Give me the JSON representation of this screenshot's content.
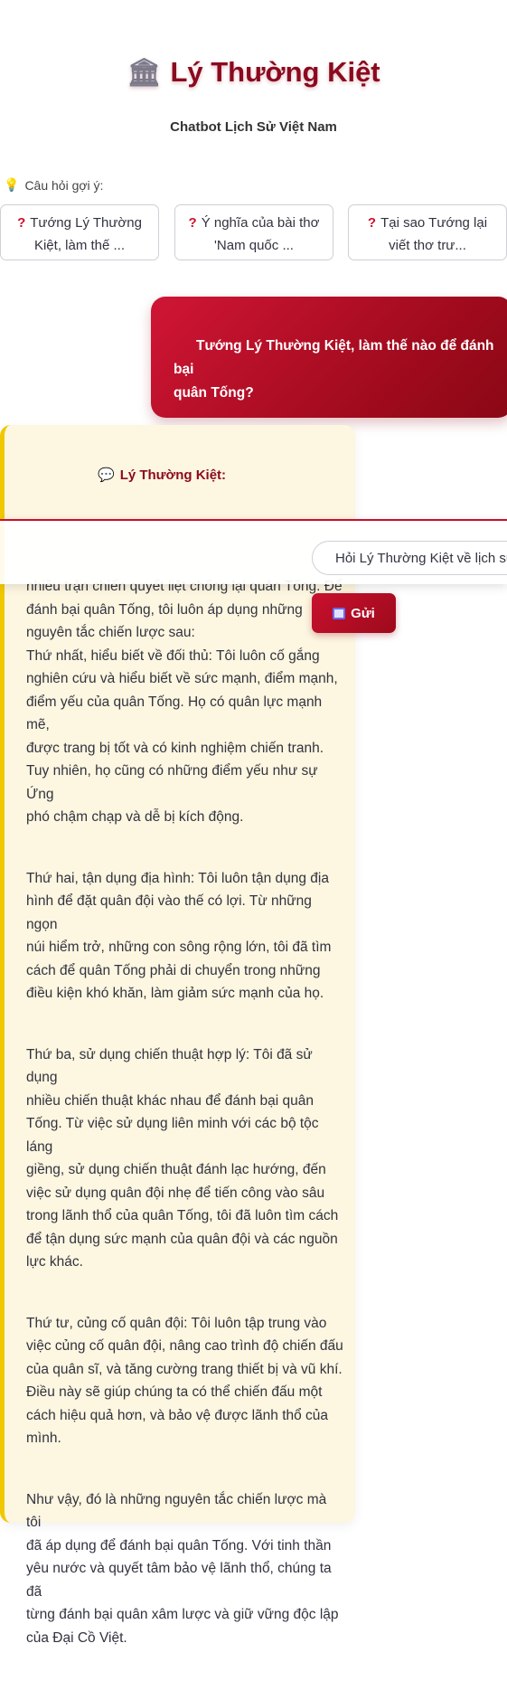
{
  "header": {
    "icon": "temple-icon",
    "title": "Lý Thường Kiệt",
    "subtitle": "Chatbot Lịch Sử Việt Nam"
  },
  "suggestions": {
    "label": "Câu hỏi gợi ý:",
    "icon": "lightbulb-icon",
    "items": [
      {
        "icon": "question-icon",
        "line1": "Tướng Lý Thường",
        "line2": "Kiệt, làm thế ..."
      },
      {
        "icon": "question-icon",
        "line1": "Ý nghĩa của bài thơ",
        "line2": "'Nam quốc ..."
      },
      {
        "icon": "question-icon",
        "line1": "Tại sao Tướng lại",
        "line2": "viết thơ trư..."
      }
    ]
  },
  "conversation": {
    "user_message": {
      "line1": "Tướng Lý Thường Kiệt, làm thế nào để đánh bại",
      "line2": "quân Tống?"
    },
    "bot_message": {
      "icon": "speech-bubble-icon",
      "sender": "Lý Thường Kiệt:",
      "paragraphs": [
        [
          "nhiều trận chiến quyết liệt chống lại quân Tống. Để",
          "đánh bại quân Tống, tôi luôn áp dụng những",
          "nguyên tắc chiến lược sau:",
          "Thứ nhất, hiểu biết về đối thủ: Tôi luôn cố gắng",
          "nghiên cứu và hiểu biết về sức mạnh, điểm mạnh,",
          "điểm yếu của quân Tống. Họ có quân lực mạnh mẽ,",
          "được trang bị tốt và có kinh nghiệm chiến tranh.",
          "Tuy nhiên, họ cũng có những điểm yếu như sự Ứng",
          "phó chậm chạp và dễ bị kích động."
        ],
        [
          "Thứ hai, tận dụng địa hình: Tôi luôn tận dụng địa",
          "hình để đặt quân đội vào thế có lợi. Từ những ngọn",
          "núi hiểm trở, những con sông rộng lớn, tôi đã tìm",
          "cách để quân Tống phải di chuyển trong những",
          "điều kiện khó khăn, làm giảm sức mạnh của họ."
        ],
        [
          "Thứ ba, sử dụng chiến thuật hợp lý: Tôi đã sử dụng",
          "nhiều chiến thuật khác nhau để đánh bại quân",
          "Tống. Từ việc sử dụng liên minh với các bộ tộc láng",
          "giềng, sử dụng chiến thuật đánh lạc hướng, đến",
          "việc sử dụng quân đội nhẹ để tiến công vào sâu",
          "trong lãnh thổ của quân Tống, tôi đã luôn tìm cách",
          "để tận dụng sức mạnh của quân đội và các nguồn",
          "lực khác."
        ],
        [
          "Thứ tư, củng cố quân đội: Tôi luôn tập trung vào",
          "việc củng cố quân đội, nâng cao trình độ chiến đấu",
          "của quân sĩ, và tăng cường trang thiết bị và vũ khí.",
          "Điều này sẽ giúp chúng ta có thể chiến đấu một",
          "cách hiệu quả hơn, và bảo vệ được lãnh thổ của",
          "mình."
        ],
        [
          "Như vậy, đó là những nguyên tắc chiến lược mà tôi",
          "đã áp dụng để đánh bại quân Tống. Với tinh thần",
          "yêu nước và quyết tâm bảo vệ lãnh thổ, chúng ta đã",
          "từng đánh bại quân xâm lược và giữ vững độc lập",
          "của Đại Cồ Việt."
        ]
      ]
    }
  },
  "input": {
    "value": "Hỏi Lý Thường Kiệt về lịch sử"
  },
  "send_button": {
    "icon": "inbox-tray-icon",
    "label": "Gửi"
  },
  "colors": {
    "accent": "#8b0a1e",
    "user_bubble": "#c8102e",
    "bot_card_bg": "#fdf6e0",
    "bot_card_border": "#f0c800"
  }
}
